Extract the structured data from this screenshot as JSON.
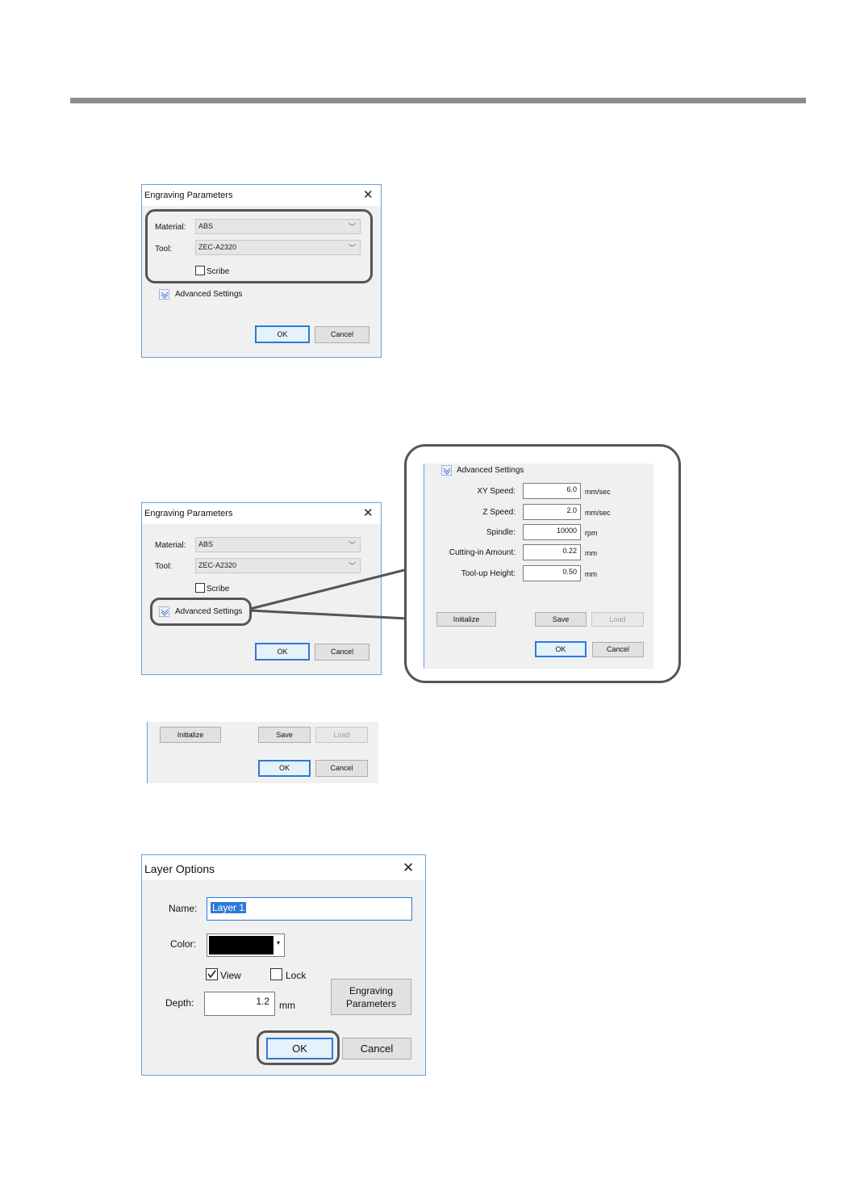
{
  "dialog1": {
    "title": "Engraving Parameters",
    "material_label": "Material:",
    "material_value": "ABS",
    "tool_label": "Tool:",
    "tool_value": "ZEC-A2320",
    "scribe_label": "Scribe",
    "advanced_label": "Advanced Settings",
    "ok_label": "OK",
    "cancel_label": "Cancel"
  },
  "dialog2": {
    "title": "Engraving Parameters",
    "material_label": "Material:",
    "material_value": "ABS",
    "tool_label": "Tool:",
    "tool_value": "ZEC-A2320",
    "scribe_label": "Scribe",
    "advanced_label": "Advanced Settings",
    "ok_label": "OK",
    "cancel_label": "Cancel"
  },
  "advanced": {
    "header_label": "Advanced Settings",
    "fields": [
      {
        "label": "XY Speed:",
        "value": "6.0",
        "unit": "mm/sec"
      },
      {
        "label": "Z Speed:",
        "value": "2.0",
        "unit": "mm/sec"
      },
      {
        "label": "Spindle:",
        "value": "10000",
        "unit": "rpm"
      },
      {
        "label": "Cutting-in Amount:",
        "value": "0.22",
        "unit": "mm"
      },
      {
        "label": "Tool-up Height:",
        "value": "0.50",
        "unit": "mm"
      }
    ],
    "initialize_label": "Initialize",
    "save_label": "Save",
    "load_label": "Load",
    "ok_label": "OK",
    "cancel_label": "Cancel"
  },
  "strip": {
    "initialize_label": "Initialize",
    "save_label": "Save",
    "load_label": "Load",
    "ok_label": "OK",
    "cancel_label": "Cancel"
  },
  "layer_options": {
    "title": "Layer Options",
    "name_label": "Name:",
    "name_value": "Layer 1",
    "color_label": "Color:",
    "color_value": "#000000",
    "view_label": "View",
    "view_checked": true,
    "lock_label": "Lock",
    "lock_checked": false,
    "depth_label": "Depth:",
    "depth_value": "1.2",
    "depth_unit": "mm",
    "engraving_button_line1": "Engraving",
    "engraving_button_line2": "Parameters",
    "ok_label": "OK",
    "cancel_label": "Cancel"
  },
  "colors": {
    "accent_border": "#2d7ad6",
    "highlight_frame": "#555555",
    "top_rule": "#8c8c8c"
  }
}
